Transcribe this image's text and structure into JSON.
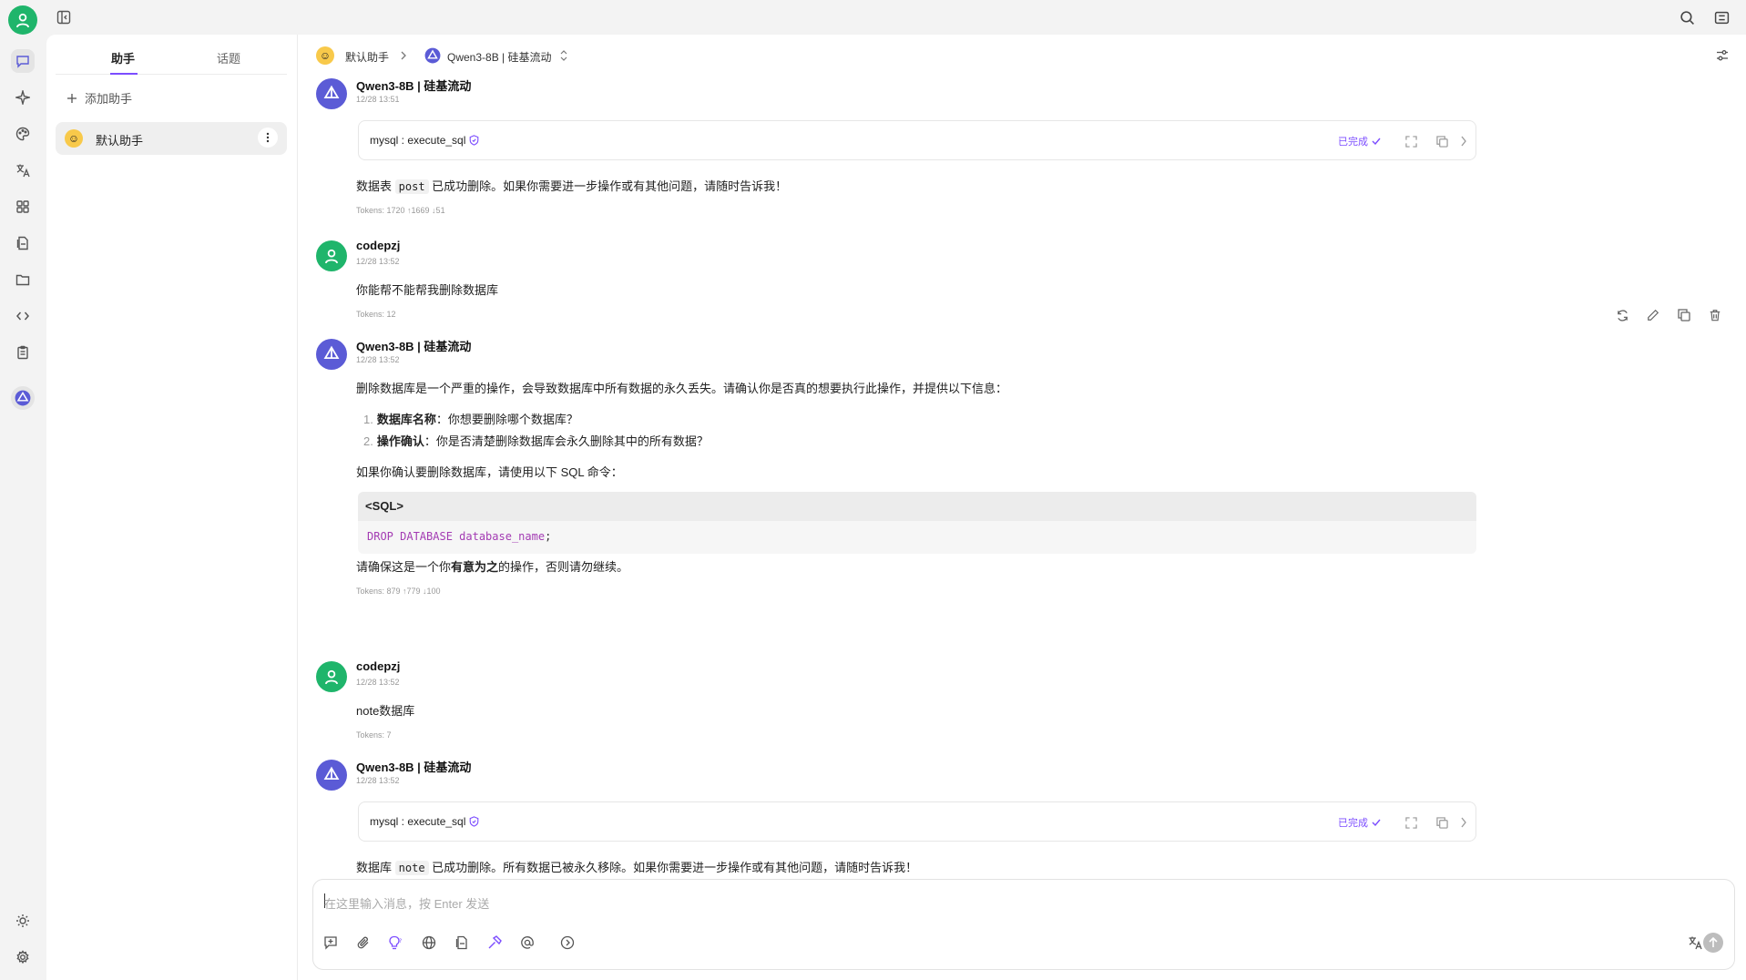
{
  "sidebar": {
    "tabs": [
      {
        "label": "助手"
      },
      {
        "label": "话题"
      }
    ],
    "add_assistant": "添加助手",
    "assistant_item": "默认助手"
  },
  "header": {
    "assistant": "默认助手",
    "model": "Qwen3-8B | 硅基流动"
  },
  "messages": [
    {
      "name": "Qwen3-8B | 硅基流动",
      "time": "12/28 13:51",
      "tool": {
        "label": "mysql : execute_sql",
        "status": "已完成"
      },
      "text_pre": "数据表",
      "code": "post",
      "text_post": "已成功删除。如果你需要进一步操作或有其他问题，请随时告诉我！",
      "tokens": "Tokens: 1720 ↑1669 ↓51"
    },
    {
      "name": "codepzj",
      "time": "12/28 13:52",
      "text": "你能帮不能帮我删除数据库",
      "tokens": "Tokens: 12"
    },
    {
      "name": "Qwen3-8B | 硅基流动",
      "time": "12/28 13:52",
      "intro": "删除数据库是一个严重的操作，会导致数据库中所有数据的永久丢失。请确认你是否真的想要执行此操作，并提供以下信息：",
      "list": [
        {
          "num": "1.",
          "bold": "数据库名称",
          "rest": "：你想要删除哪个数据库？"
        },
        {
          "num": "2.",
          "bold": "操作确认",
          "rest": "：你是否清楚删除数据库会永久删除其中的所有数据？"
        }
      ],
      "before_code": "如果你确认要删除数据库，请使用以下 SQL 命令：",
      "code_lang": "<SQL>",
      "code_kw": "DROP DATABASE database_name",
      "code_semi": ";",
      "outro_pre": "请确保这是一个你",
      "outro_bold": "有意为之",
      "outro_post": "的操作，否则请勿继续。",
      "tokens": "Tokens: 879 ↑779 ↓100"
    },
    {
      "name": "codepzj",
      "time": "12/28 13:52",
      "text": "note数据库",
      "tokens": "Tokens: 7"
    },
    {
      "name": "Qwen3-8B | 硅基流动",
      "time": "12/28 13:52",
      "tool": {
        "label": "mysql : execute_sql",
        "status": "已完成"
      },
      "text_pre": "数据库",
      "code": "note",
      "text_post": "已成功删除。所有数据已被永久移除。如果你需要进一步操作或有其他问题，请随时告诉我！"
    }
  ],
  "input": {
    "placeholder": "在这里输入消息，按 Enter 发送"
  },
  "colors": {
    "accent": "#7c4dff",
    "user_avatar": "#1fb56b",
    "bot_avatar": "#5b5bd6"
  }
}
